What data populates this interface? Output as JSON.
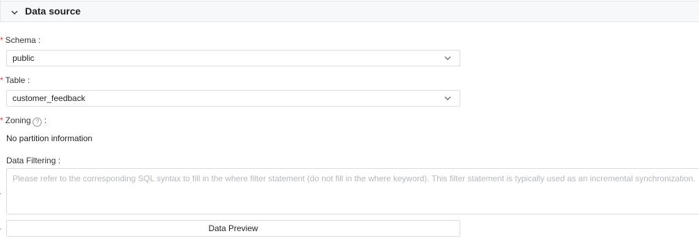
{
  "section": {
    "title": "Data source",
    "icon": "chevron-down-icon"
  },
  "schema": {
    "label": "Schema",
    "required_mark": "*",
    "colon": ":",
    "value": "public"
  },
  "table": {
    "label": "Table",
    "required_mark": "*",
    "colon": ":",
    "value": "customer_feedback"
  },
  "zoning": {
    "label": "Zoning",
    "required_mark": "*",
    "colon": ":",
    "help_glyph": "?",
    "info": "No partition information"
  },
  "filtering": {
    "label": "Data Filtering",
    "colon": ":",
    "placeholder": "Please refer to the corresponding SQL syntax to fill in the where filter statement (do not fill in the where keyword). This filter statement is typically used as an incremental synchronization."
  },
  "preview": {
    "label": "Data Preview"
  },
  "colors": {
    "required": "#e23c39",
    "border": "#d9dbe0",
    "header_bg": "#f7f8fa",
    "placeholder": "#b5b8bf"
  }
}
